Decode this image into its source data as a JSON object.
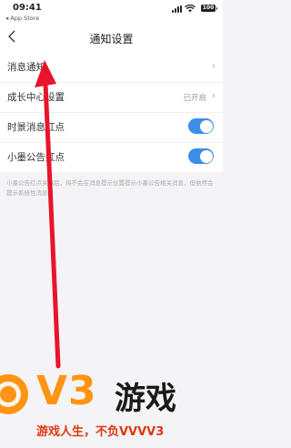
{
  "status_bar": {
    "time": "09:41",
    "back_to_app": "◂ App Store",
    "battery": "100"
  },
  "nav": {
    "title": "通知设置"
  },
  "rows": [
    {
      "label": "消息通知",
      "kind": "chevron",
      "value": ""
    },
    {
      "label": "成长中心设置",
      "kind": "chevron",
      "value": "已开启"
    },
    {
      "label": "时景消息红点",
      "kind": "toggle",
      "on": true
    },
    {
      "label": "小墨公告红点",
      "kind": "toggle",
      "on": true
    }
  ],
  "note": "小墨公告红点关掉后，将不会在消息提示位置提示小墨公告相关消息，但依然会提示系统性消息",
  "watermark": {
    "brand": "V3",
    "brand_text": "游戏",
    "slogan": "游戏人生，不负VVVV3"
  },
  "colors": {
    "accent": "#3d8ee6",
    "arrow": "#e8142c",
    "watermark_orange": "#ff9414"
  }
}
